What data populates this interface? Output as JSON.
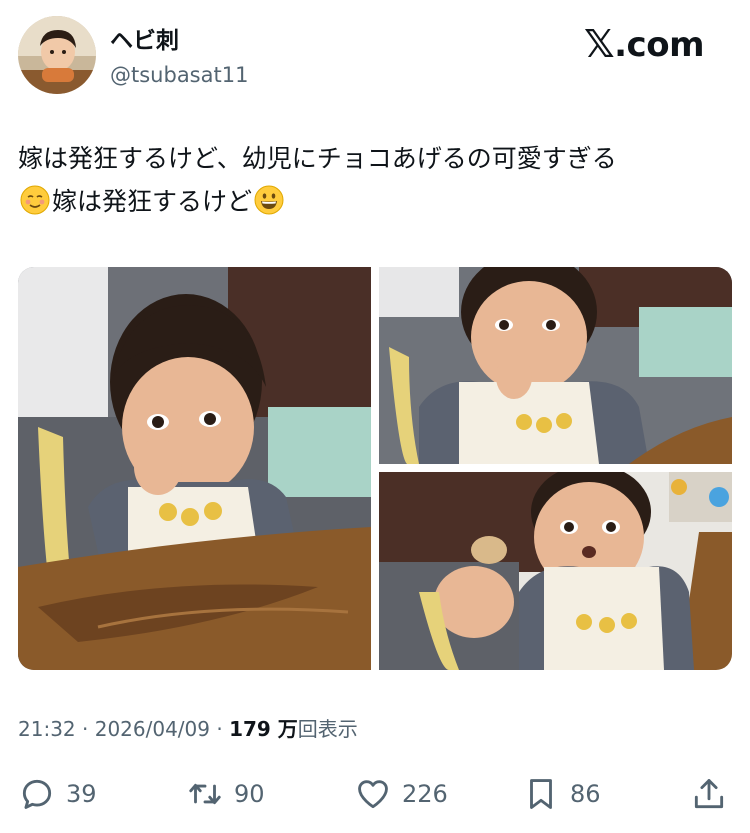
{
  "author": {
    "display_name": "ヘビ刺",
    "handle": "@tsubasat11"
  },
  "brand": {
    "glyph": "𝕏",
    "suffix": ".com"
  },
  "tweet": {
    "line1": "嫁は発狂するけど、幼児にチョコあげるの可愛すぎる",
    "line2": "嫁は発狂するけど",
    "emoji_before": "relieved-face-emoji",
    "emoji_after": "grinning-face-emoji"
  },
  "media": {
    "photo_count": 3
  },
  "meta": {
    "time": "21:32",
    "separator": "·",
    "date": "2026/04/09",
    "views_number": "179 万",
    "views_label": "回表示"
  },
  "actions": {
    "replies": "39",
    "retweets": "90",
    "likes": "226",
    "bookmarks": "86"
  },
  "colors": {
    "text_primary": "#0f1419",
    "text_secondary": "#536471",
    "background": "#ffffff"
  },
  "icons": [
    "reply-icon",
    "retweet-icon",
    "like-icon",
    "bookmark-icon",
    "share-icon"
  ]
}
